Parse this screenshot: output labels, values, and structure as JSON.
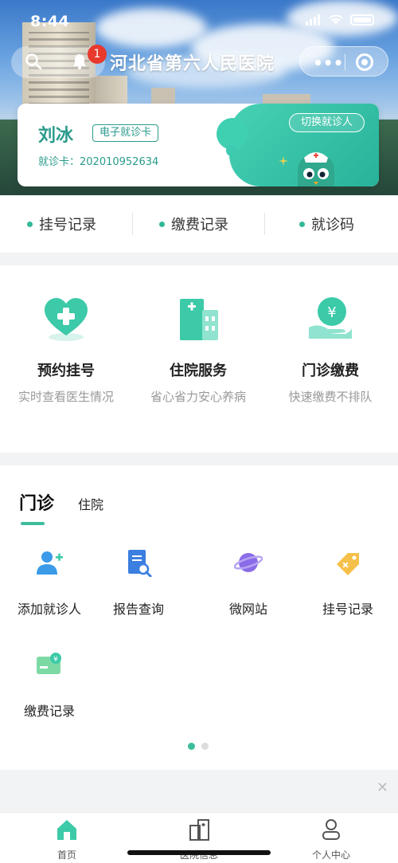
{
  "status_bar": {
    "time": "8:44"
  },
  "nav": {
    "title": "河北省第六人民医院",
    "notification_count": "1"
  },
  "patient_card": {
    "name": "刘冰",
    "tag": "电子就诊卡",
    "card_no": "就诊卡：202010952634",
    "switch_label": "切换就诊人"
  },
  "quick_links": [
    {
      "label": "挂号记录"
    },
    {
      "label": "缴费记录"
    },
    {
      "label": "就诊码"
    }
  ],
  "features": [
    {
      "title": "预约挂号",
      "desc": "实时查看医生情况",
      "icon": "heart-plus-icon"
    },
    {
      "title": "住院服务",
      "desc": "省心省力安心养病",
      "icon": "hospital-building-icon"
    },
    {
      "title": "门诊缴费",
      "desc": "快速缴费不排队",
      "icon": "yen-hand-icon"
    }
  ],
  "section": {
    "tabs": [
      {
        "label": "门诊"
      },
      {
        "label": "住院"
      }
    ],
    "items": [
      {
        "label": "添加就诊人",
        "icon": "add-user-icon"
      },
      {
        "label": "报告查询",
        "icon": "report-search-icon"
      },
      {
        "label": "微网站",
        "icon": "planet-icon"
      },
      {
        "label": "挂号记录",
        "icon": "tag-icon"
      },
      {
        "label": "缴费记录",
        "icon": "payment-card-icon"
      }
    ]
  },
  "tabbar": [
    {
      "label": "首页",
      "icon": "home-icon"
    },
    {
      "label": "医院信息",
      "icon": "hospital-info-icon"
    },
    {
      "label": "个人中心",
      "icon": "user-center-icon"
    }
  ],
  "colors": {
    "accent": "#3dbd9c",
    "badge": "#e8392d"
  }
}
